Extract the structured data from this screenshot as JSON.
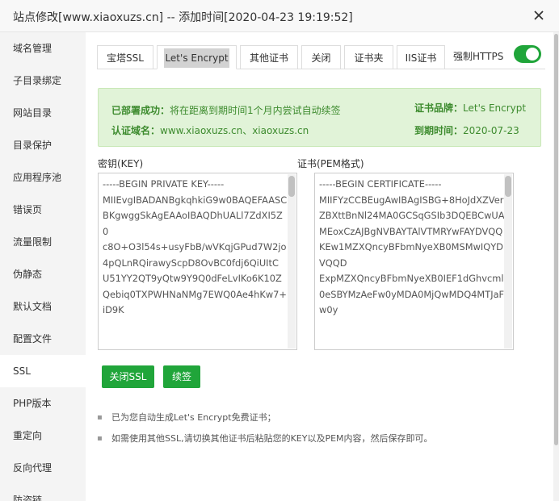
{
  "title": "站点修改[www.xiaoxuzs.cn] -- 添加时间[2020-04-23 19:19:52]",
  "sidebar": {
    "items": [
      {
        "label": "域名管理"
      },
      {
        "label": "子目录绑定"
      },
      {
        "label": "网站目录"
      },
      {
        "label": "目录保护"
      },
      {
        "label": "应用程序池"
      },
      {
        "label": "错误页"
      },
      {
        "label": "流量限制"
      },
      {
        "label": "伪静态"
      },
      {
        "label": "默认文档"
      },
      {
        "label": "配置文件"
      },
      {
        "label": "SSL"
      },
      {
        "label": "PHP版本"
      },
      {
        "label": "重定向"
      },
      {
        "label": "反向代理"
      },
      {
        "label": "防盗链"
      }
    ],
    "active_index": 10
  },
  "tabs": [
    {
      "label": "宝塔SSL"
    },
    {
      "label": "Let's Encrypt"
    },
    {
      "label": "其他证书"
    },
    {
      "label": "关闭"
    },
    {
      "label": "证书夹"
    },
    {
      "label": "IIS证书"
    }
  ],
  "https": {
    "label": "强制HTTPS",
    "enabled": true
  },
  "alert": {
    "deploy_status_label": "已部署成功：",
    "deploy_status_text": "将在距离到期时间1个月内尝试自动续签",
    "domain_label": "认证域名：",
    "domain_value": "www.xiaoxuzs.cn、xiaoxuzs.cn",
    "brand_label": "证书品牌：",
    "brand_value": "Let's Encrypt",
    "expiry_label": "到期时间：",
    "expiry_value": "2020-07-23"
  },
  "key": {
    "label": "密钥(KEY)",
    "value": "-----BEGIN PRIVATE KEY-----\nMIIEvgIBADANBgkqhkiG9w0BAQEFAASCBKgwggSkAgEAAoIBAQDhUALl7ZdXI5Z0\nc8O+O3l54s+usyFbB/wVKqjGPud7W2jo4pQLnRQirawyScpD8OvBC0fdj6QiUItC\nU51YY2QT9yQtw9Y9Q0dFeLvIKo6K10ZQebiq0TXPWHNaNMg7EWQ0Ae4hKw7+iD9K"
  },
  "cert": {
    "label": "证书(PEM格式)",
    "value": "-----BEGIN CERTIFICATE-----\nMIIFYzCCBEugAwIBAgISBG+8HoJdXZVerZBXttBnNl24MA0GCSqGSIb3DQEBCwUA\nMEoxCzAJBgNVBAYTAlVTMRYwFAYDVQQKEw1MZXQncyBFbmNyeXB0MSMwIQYDVQQD\nExpMZXQncyBFbmNyeXB0IEF1dGhvcml0eSBYMzAeFw0yMDA0MjQwMDQ4MTJaFw0y"
  },
  "buttons": {
    "close_ssl": "关闭SSL",
    "renew": "续签"
  },
  "notes": [
    "已为您自动生成Let's Encrypt免费证书；",
    "如需使用其他SSL,请切换其他证书后粘贴您的KEY以及PEM内容，然后保存即可。"
  ],
  "colors": {
    "accent": "#20a53a",
    "alert_bg": "#e1f3d8",
    "alert_text": "#3d8b2e"
  }
}
